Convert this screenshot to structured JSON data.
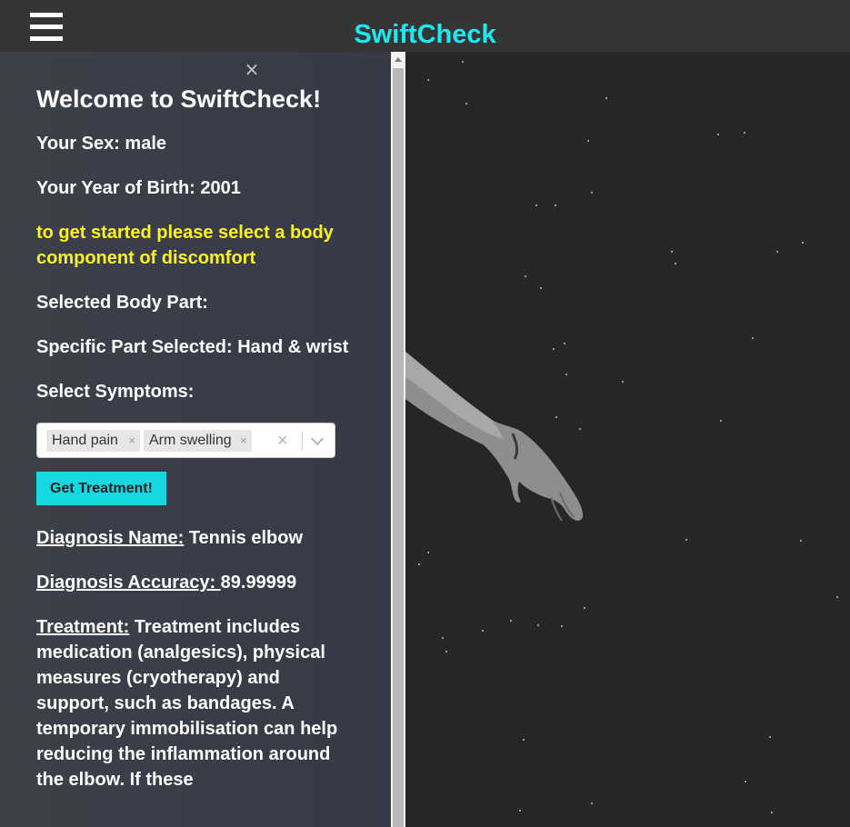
{
  "header": {
    "title": "SwiftCheck",
    "menu_icon": "hamburger-menu-icon"
  },
  "panel": {
    "close_label": "×",
    "welcome": "Welcome to SwiftCheck!",
    "sex_line": "Your Sex: male",
    "birth_line": "Your Year of Birth: 2001",
    "hint": "to get started please select a body component of discomfort",
    "selected_body_part": "Selected Body Part:",
    "specific_part": "Specific Part Selected: Hand & wrist",
    "symptoms_label": "Select Symptoms:",
    "symptoms": [
      "Hand pain",
      "Arm swelling"
    ],
    "tag_remove": "×",
    "clear_label": "×",
    "button_label": "Get Treatment!",
    "diagnosis_name_label": "Diagnosis Name:",
    "diagnosis_name_value": " Tennis elbow",
    "diagnosis_accuracy_label": "Diagnosis Accuracy: ",
    "diagnosis_accuracy_value": "89.99999",
    "treatment_label": "Treatment:",
    "treatment_value": " Treatment includes medication (analgesics), physical measures (cryotherapy) and support, such as bandages. A temporary immobilisation can help reducing the inflammation around the elbow. If these"
  },
  "colors": {
    "brand": "#1de9f2",
    "hint": "#fbf420",
    "button": "#17d8e0",
    "panel": "#3a3d47",
    "scene": "#262626"
  }
}
